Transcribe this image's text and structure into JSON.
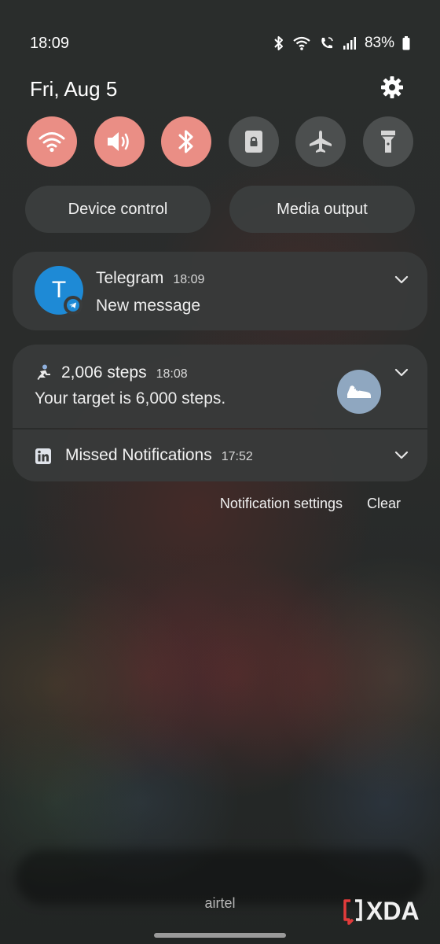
{
  "status_bar": {
    "time": "18:09",
    "battery": "83%"
  },
  "header": {
    "date": "Fri, Aug 5"
  },
  "quick_toggles": [
    {
      "icon": "wifi-icon",
      "active": true
    },
    {
      "icon": "sound-icon",
      "active": true
    },
    {
      "icon": "bluetooth-icon",
      "active": true
    },
    {
      "icon": "rotation-lock-icon",
      "active": false
    },
    {
      "icon": "airplane-icon",
      "active": false
    },
    {
      "icon": "flashlight-icon",
      "active": false
    }
  ],
  "buttons": {
    "device_control": "Device control",
    "media_output": "Media output"
  },
  "notifications": {
    "telegram": {
      "avatar_letter": "T",
      "app": "Telegram",
      "time": "18:09",
      "message": "New message"
    },
    "steps": {
      "title": "2,006 steps",
      "time": "18:08",
      "message": "Your target is 6,000 steps."
    },
    "linkedin": {
      "title": "Missed Notifications",
      "time": "17:52"
    }
  },
  "actions": {
    "settings": "Notification settings",
    "clear": "Clear"
  },
  "carrier": "airtel",
  "watermark": "XDA",
  "colors": {
    "toggle_on": "#ea8e85",
    "toggle_off": "#4c4f4f",
    "telegram_blue": "#1e8ad6",
    "shoe_badge": "#8fa7c0"
  }
}
